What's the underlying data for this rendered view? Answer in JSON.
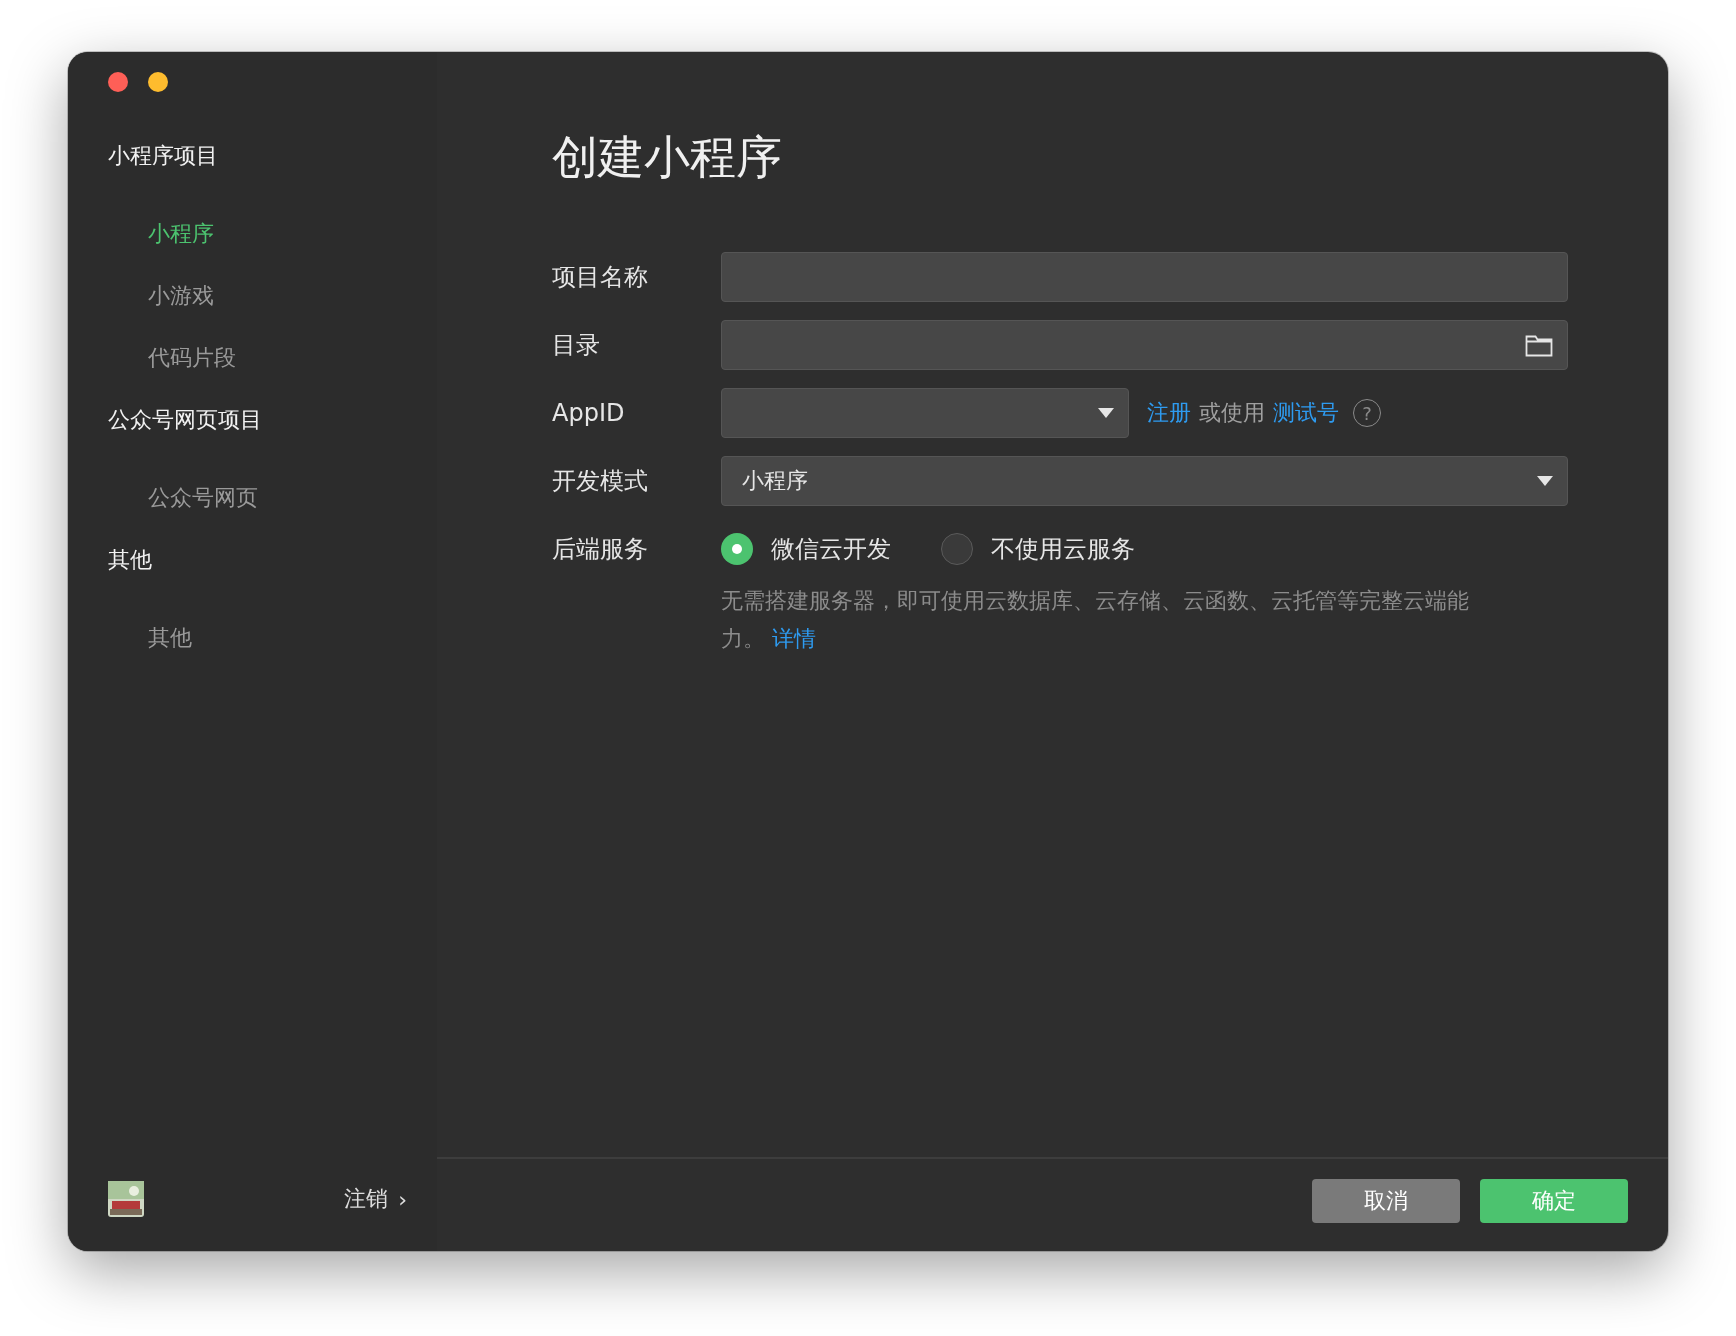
{
  "sidebar": {
    "groups": [
      {
        "title": "小程序项目",
        "items": [
          {
            "label": "小程序",
            "selected": true
          },
          {
            "label": "小游戏",
            "selected": false
          },
          {
            "label": "代码片段",
            "selected": false
          }
        ]
      },
      {
        "title": "公众号网页项目",
        "items": [
          {
            "label": "公众号网页",
            "selected": false
          }
        ]
      },
      {
        "title": "其他",
        "items": [
          {
            "label": "其他",
            "selected": false
          }
        ]
      }
    ],
    "footer": {
      "logout": "注销",
      "chevron": "›"
    }
  },
  "form": {
    "title": "创建小程序",
    "fields": [
      {
        "kind": "text",
        "label": "项目名称"
      },
      {
        "kind": "folder",
        "label": "目录"
      },
      {
        "kind": "appid",
        "label": "AppID",
        "register": "注册",
        "or_use": "或使用",
        "test_account": "测试号",
        "help": "?"
      },
      {
        "kind": "select",
        "label": "开发模式",
        "value": "小程序"
      },
      {
        "kind": "radio",
        "label": "后端服务",
        "options": [
          {
            "label": "微信云开发",
            "selected": true
          },
          {
            "label": "不使用云服务",
            "selected": false
          }
        ],
        "description": "无需搭建服务器，即可使用云数据库、云存储、云函数、云托管等完整云端能力。",
        "link": "详情"
      }
    ]
  },
  "buttons": [
    {
      "label": "取消",
      "kind": "secondary"
    },
    {
      "label": "确定",
      "kind": "primary"
    }
  ]
}
